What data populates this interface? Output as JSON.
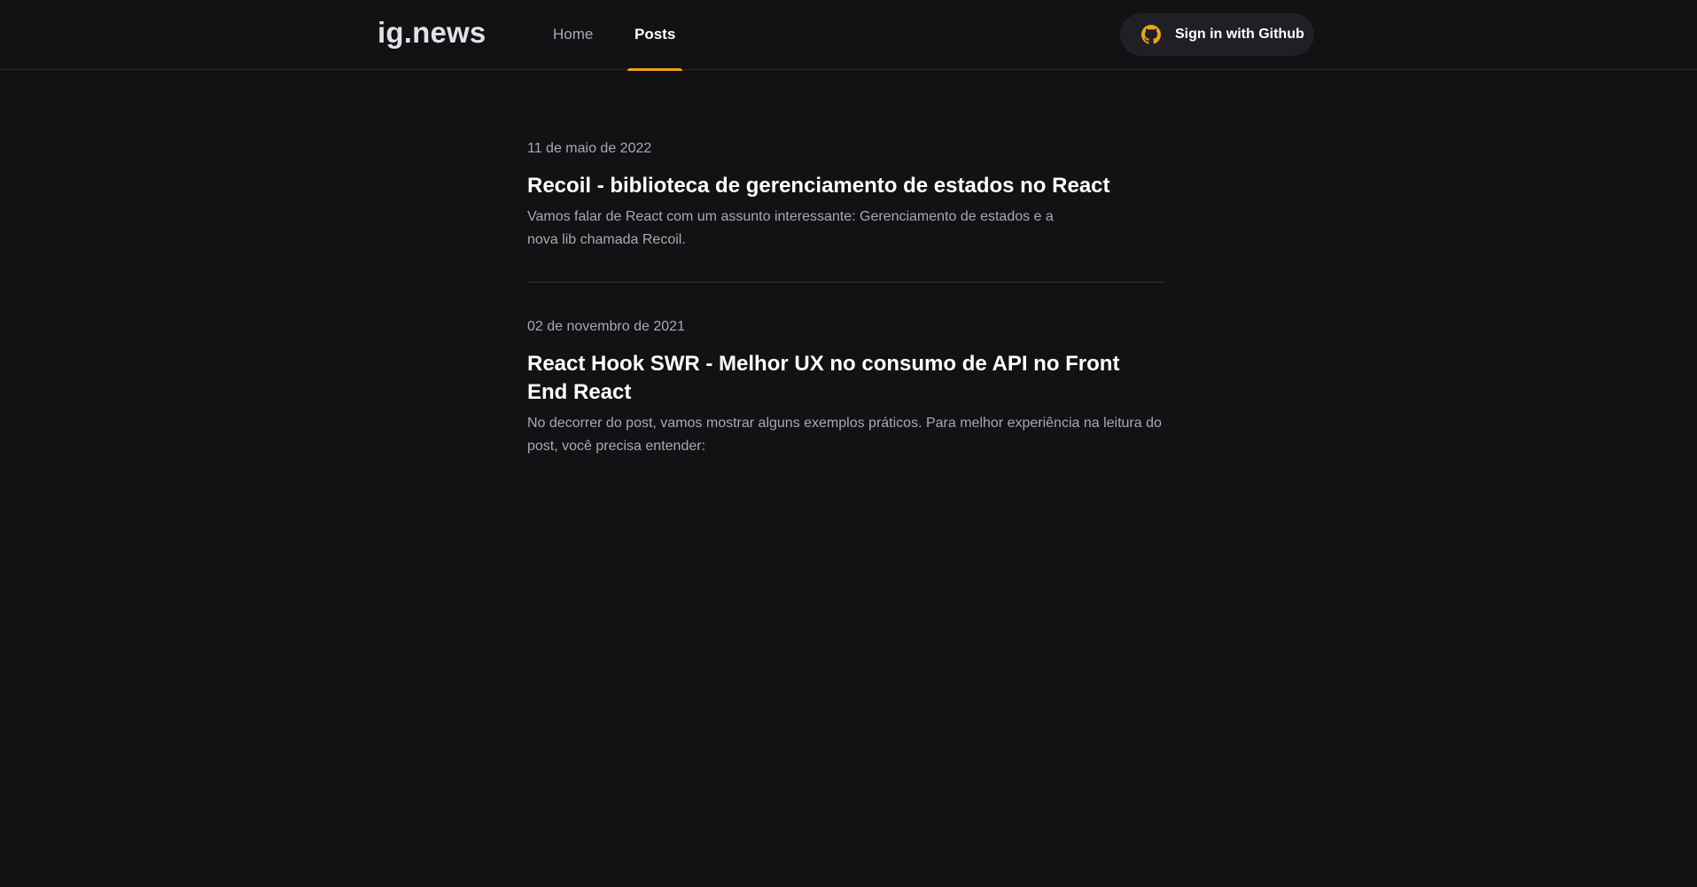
{
  "header": {
    "logo": "ig.news",
    "nav": [
      {
        "label": "Home",
        "active": false
      },
      {
        "label": "Posts",
        "active": true
      }
    ],
    "signin_label": "Sign in with Github",
    "signin_icon": "github-icon"
  },
  "colors": {
    "background": "#121214",
    "accent": "#eba417",
    "text_muted": "#a8a8b3",
    "button_bg": "#202024"
  },
  "posts": [
    {
      "date": "11 de maio de 2022",
      "title": "Recoil - biblioteca de gerenciamento de estados no React",
      "excerpt": "Vamos falar de React com um assunto interessante: Gerenciamento de estados e a nova lib chamada Recoil."
    },
    {
      "date": "02 de novembro de 2021",
      "title": "React Hook SWR - Melhor UX no consumo de API no Front End React",
      "excerpt": "No decorrer do post, vamos mostrar alguns exemplos práticos. Para melhor experiência na leitura do post, você precisa entender:"
    }
  ]
}
